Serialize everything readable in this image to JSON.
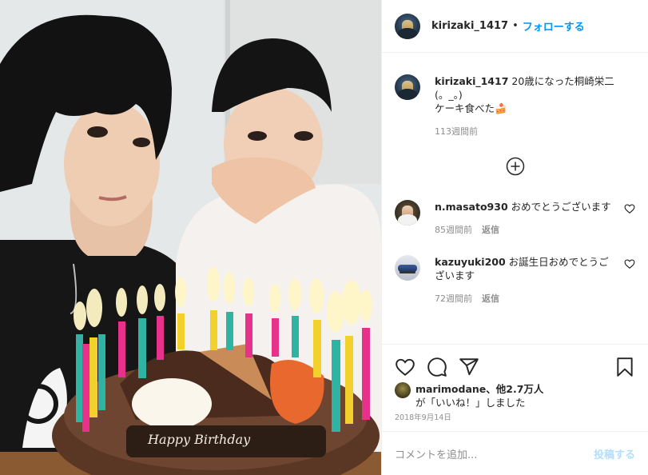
{
  "post": {
    "username": "kirizaki_1417",
    "separator": "•",
    "follow_label": "フォローする"
  },
  "caption": {
    "username": "kirizaki_1417",
    "text_line1": "20歳になった桐崎栄二(。_。)",
    "text_line2": "ケーキ食べた🍰",
    "time": "113週間前"
  },
  "load_more_icon": "plus-circle-icon",
  "comments": [
    {
      "username": "n.masato930",
      "text": "おめでとうございます",
      "time": "85週間前",
      "reply_label": "返信"
    },
    {
      "username": "kazuyuki200",
      "text": "お誕生日おめでとうございます",
      "time": "72週間前",
      "reply_label": "返信"
    }
  ],
  "likes": {
    "user": "marimodane",
    "rest": "、他2.7万人",
    "line2": "が「いいね！」しました"
  },
  "date": "2018年9月14日",
  "add_comment": {
    "placeholder": "コメントを追加...",
    "post_label": "投稿する"
  },
  "photo": {
    "cake_text": "Happy Birthday"
  },
  "colors": {
    "accent": "#0095f6",
    "post_disabled": "#b2dffc",
    "muted": "#8e8e8e",
    "text": "#262626"
  }
}
